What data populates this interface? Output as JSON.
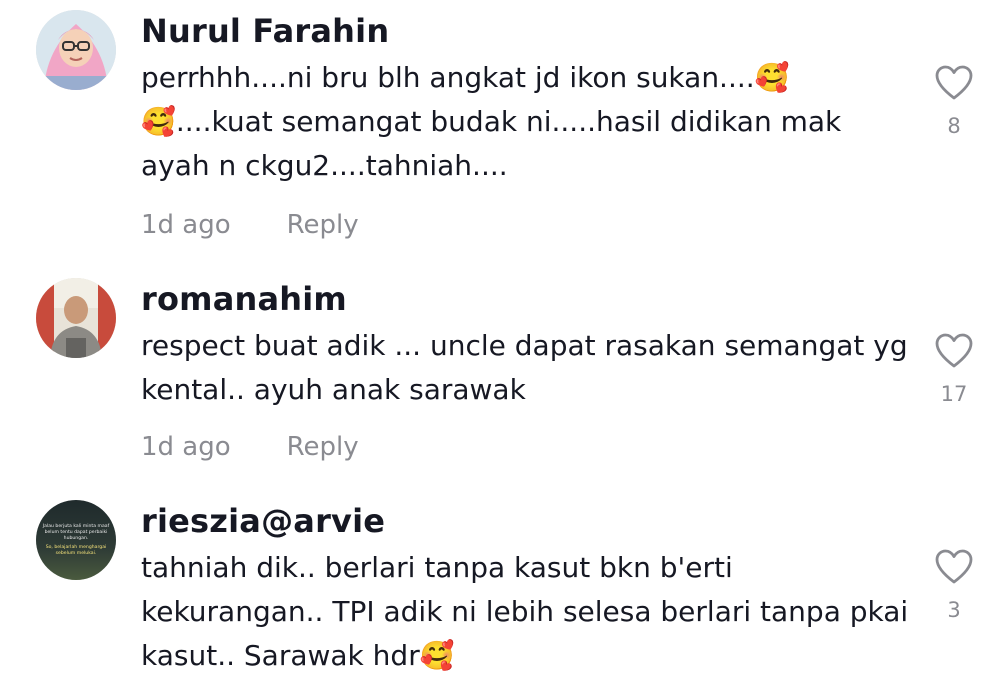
{
  "comments": [
    {
      "username": "Nurul Farahin",
      "text": "perrhhh....ni bru blh angkat jd ikon sukan....🥰🥰....kuat semangat budak ni.....hasil didikan mak ayah n ckgu2....tahniah....",
      "time": "1d ago",
      "reply_label": "Reply",
      "likes": "8",
      "avatar_icon": "profile-photo-hijab"
    },
    {
      "username": "romanahim",
      "text": "respect buat adik ... uncle dapat rasakan semangat yg kental.. ayuh anak sarawak",
      "time": "1d ago",
      "reply_label": "Reply",
      "likes": "17",
      "avatar_icon": "profile-photo-man"
    },
    {
      "username": "rieszia@arvie",
      "text": "tahniah dik.. berlari tanpa kasut bkn b'erti kekurangan.. TPI adik ni lebih selesa berlari tanpa pkai kasut.. Sarawak hdr🥰",
      "time": "",
      "reply_label": "",
      "likes": "3",
      "avatar_icon": "profile-photo-quote-image",
      "avatar_text": [
        "Jalau berjuta kali minta maaf",
        "belum tentu dapat perbaiki",
        "hubungan.",
        "So, belajarlah menghargai",
        "sebelum melukai."
      ]
    }
  ],
  "colors": {
    "text": "#161823",
    "muted": "#8a8b91",
    "icon": "#8a8b91"
  }
}
